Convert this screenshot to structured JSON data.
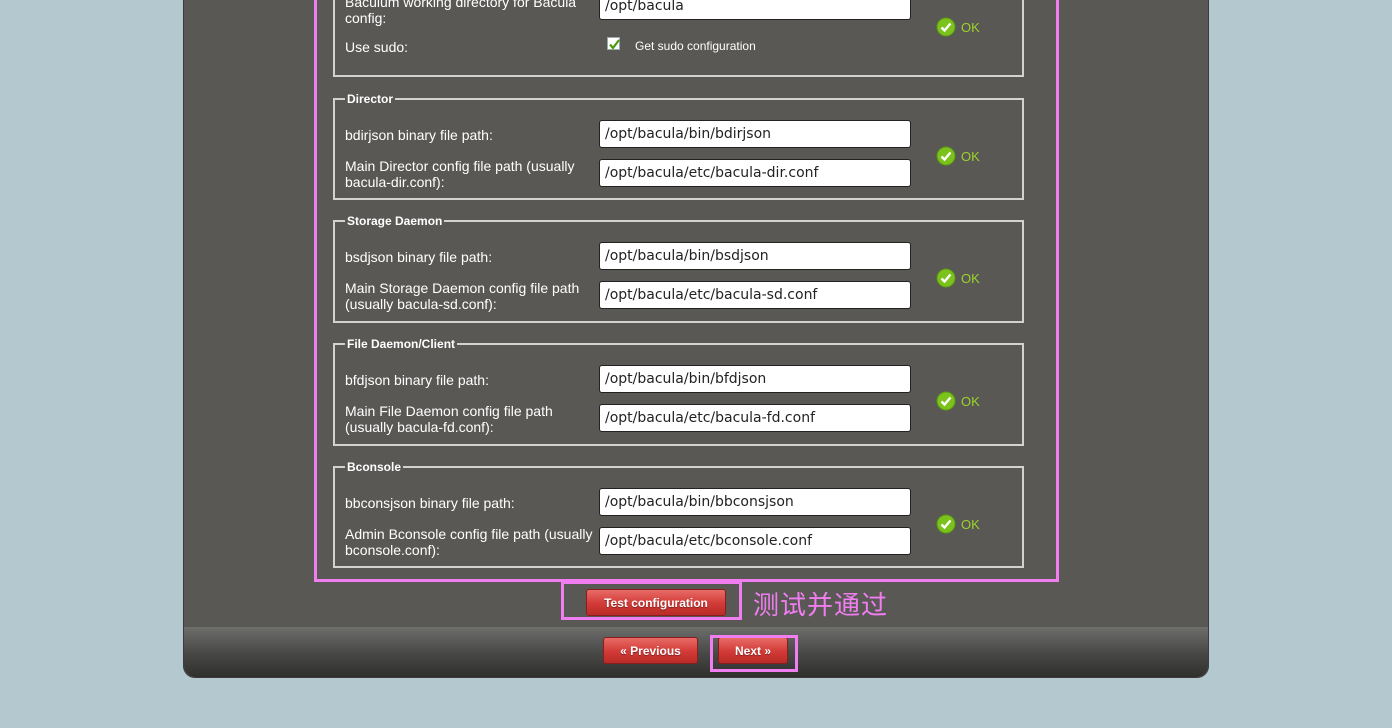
{
  "general": {
    "workdir_label": "Baculum working directory for Bacula config:",
    "workdir_value": "/opt/bacula",
    "sudo_label": "Use sudo:",
    "sudo_checked": true,
    "sudo_checkbox_label": "Get sudo configuration",
    "status": "OK"
  },
  "director": {
    "legend": "Director",
    "binary_label": "bdirjson binary file path:",
    "binary_value": "/opt/bacula/bin/bdirjson",
    "config_label": "Main Director config file path (usually bacula-dir.conf):",
    "config_value": "/opt/bacula/etc/bacula-dir.conf",
    "status": "OK"
  },
  "storage": {
    "legend": "Storage Daemon",
    "binary_label": "bsdjson binary file path:",
    "binary_value": "/opt/bacula/bin/bsdjson",
    "config_label": "Main Storage Daemon config file path (usually bacula-sd.conf):",
    "config_value": "/opt/bacula/etc/bacula-sd.conf",
    "status": "OK"
  },
  "filedaemon": {
    "legend": "File Daemon/Client",
    "binary_label": "bfdjson binary file path:",
    "binary_value": "/opt/bacula/bin/bfdjson",
    "config_label": "Main File Daemon config file path (usually bacula-fd.conf):",
    "config_value": "/opt/bacula/etc/bacula-fd.conf",
    "status": "OK"
  },
  "bconsole": {
    "legend": "Bconsole",
    "binary_label": "bbconsjson binary file path:",
    "binary_value": "/opt/bacula/bin/bbconsjson",
    "config_label": "Admin Bconsole config file path (usually bconsole.conf):",
    "config_value": "/opt/bacula/etc/bconsole.conf",
    "status": "OK"
  },
  "actions": {
    "test_label": "Test configuration",
    "annotation_text": "测试并通过",
    "previous_label": "« Previous",
    "next_label": "Next »"
  },
  "colors": {
    "page_background": "#b4c8d0",
    "panel": "#595855",
    "ok_green": "#9bd32a",
    "button_red": "#d23a36",
    "annotation_pink": "#f07ef0"
  }
}
